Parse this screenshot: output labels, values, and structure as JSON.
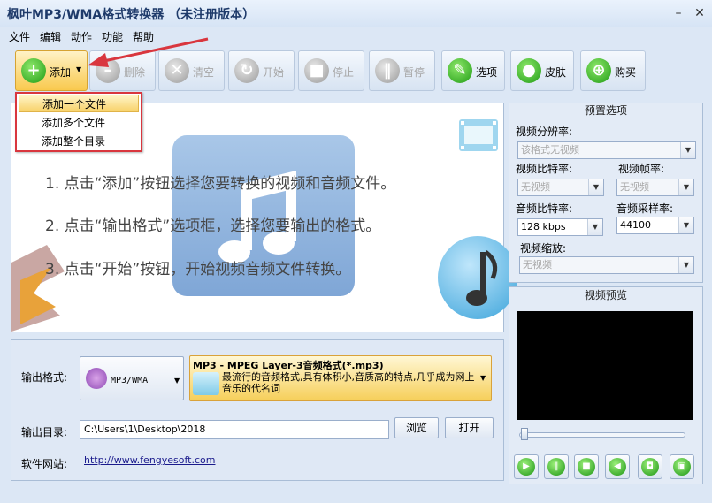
{
  "window": {
    "title": "枫叶MP3/WMA格式转换器 （未注册版本）",
    "minimize": "–",
    "close": "✕"
  },
  "menu": [
    "文件",
    "编辑",
    "动作",
    "功能",
    "帮助"
  ],
  "toolbar": {
    "add": "添加",
    "delete": "删除",
    "clear": "清空",
    "start": "开始",
    "stop": "停止",
    "pause": "暂停",
    "options": "选项",
    "skin": "皮肤",
    "buy": "购买"
  },
  "add_menu": [
    "添加一个文件",
    "添加多个文件",
    "添加整个目录"
  ],
  "instructions": [
    "1. 点击“添加”按钮选择您要转换的视频和音频文件。",
    "2. 点击“输出格式”选项框，选择您要输出的格式。",
    "3. 点击“开始”按钮，开始视频音频文件转换。"
  ],
  "output": {
    "format_label": "输出格式:",
    "format_value": "MP3/WMA",
    "format_title": "MP3 - MPEG Layer-3音频格式(*.mp3)",
    "format_desc": "最流行的音频格式,具有体积小,音质高的特点,几乎成为网上音乐的代名词",
    "dir_label": "输出目录:",
    "dir_value": "C:\\Users\\1\\Desktop\\2018",
    "browse": "浏览",
    "open": "打开",
    "site_label": "软件网站:",
    "site_url": "http://www.fengyesoft.com"
  },
  "preset": {
    "title": "预置选项",
    "video_resolution_label": "视频分辨率:",
    "video_resolution_value": "该格式无视频",
    "video_bitrate_label": "视频比特率:",
    "video_bitrate_value": "无视频",
    "video_framerate_label": "视频帧率:",
    "video_framerate_value": "无视频",
    "audio_bitrate_label": "音频比特率:",
    "audio_bitrate_value": "128 kbps",
    "audio_samplerate_label": "音频采样率:",
    "audio_samplerate_value": "44100",
    "video_scale_label": "视频缩放:",
    "video_scale_value": "无视频"
  },
  "preview": {
    "title": "视频预览"
  },
  "colors": {
    "accent_red": "#d9363e",
    "toolbar_green": "#1f9b14",
    "link_blue": "#1a1a8c"
  }
}
